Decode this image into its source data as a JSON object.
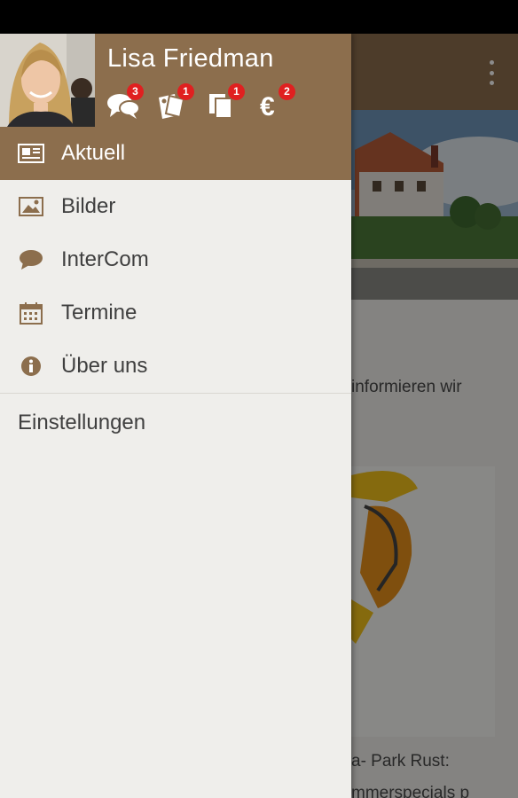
{
  "user": {
    "name": "Lisa Friedman"
  },
  "header_icons": [
    {
      "icon": "chat-bubbles-icon",
      "badge": "3"
    },
    {
      "icon": "coupons-icon",
      "badge": "1"
    },
    {
      "icon": "documents-icon",
      "badge": "1"
    },
    {
      "icon": "euro-icon",
      "badge": "2"
    }
  ],
  "menu": [
    {
      "label": "Aktuell",
      "icon": "newspaper-icon",
      "active": true
    },
    {
      "label": "Bilder",
      "icon": "image-icon",
      "active": false
    },
    {
      "label": "InterCom",
      "icon": "speech-bubble-icon",
      "active": false
    },
    {
      "label": "Termine",
      "icon": "calendar-icon",
      "active": false
    },
    {
      "label": "Über uns",
      "icon": "info-icon",
      "active": false
    }
  ],
  "settings_label": "Einstellungen",
  "background": {
    "text_line_1": "informieren wir",
    "text_line_2": "a- Park Rust:",
    "text_line_3": "mmerspecials p"
  },
  "colors": {
    "accent": "#8c6e4d",
    "badge": "#e02020",
    "drawer_bg": "#efeeeb"
  }
}
